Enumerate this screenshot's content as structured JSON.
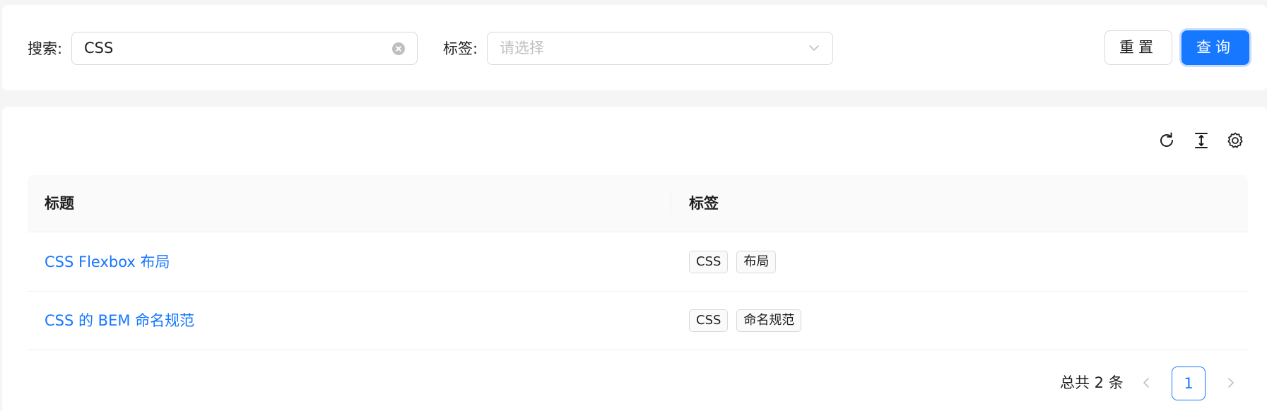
{
  "search_form": {
    "search_label": "搜索:",
    "search_value": "CSS",
    "tag_label": "标签:",
    "tag_placeholder": "请选择",
    "reset_label": "重置",
    "query_label": "查询"
  },
  "toolbar": {
    "icons": [
      "reload-icon",
      "column-height-icon",
      "setting-icon"
    ]
  },
  "table": {
    "columns": [
      "标题",
      "标签"
    ],
    "rows": [
      {
        "title": "CSS Flexbox 布局",
        "tags": [
          "CSS",
          "布局"
        ]
      },
      {
        "title": "CSS 的 BEM 命名规范",
        "tags": [
          "CSS",
          "命名规范"
        ]
      }
    ]
  },
  "pagination": {
    "total_text": "总共 2 条",
    "current_page": "1"
  },
  "colors": {
    "primary": "#1677ff",
    "border": "#d9d9d9",
    "page_bg": "#f5f5f5"
  }
}
